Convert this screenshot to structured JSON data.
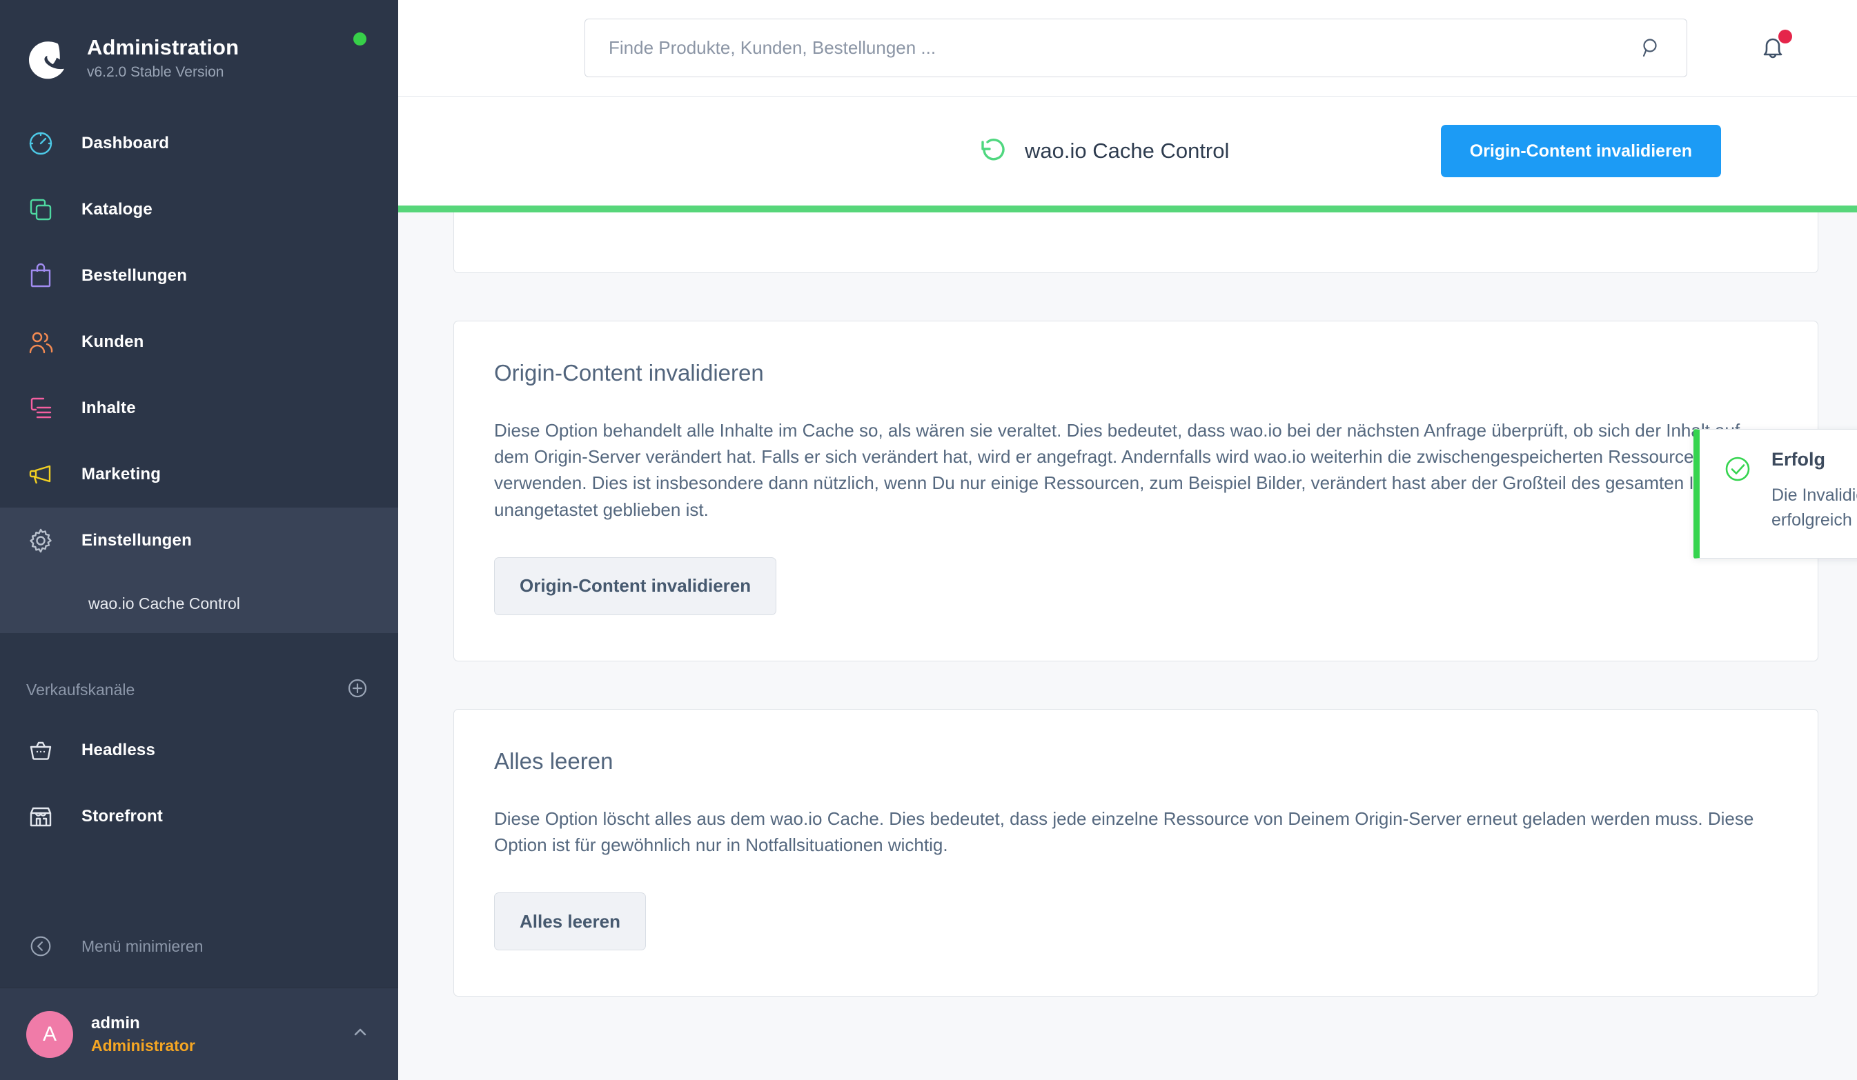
{
  "sidebar": {
    "brand": {
      "title": "Administration",
      "version": "v6.2.0 Stable Version",
      "logo_icon": "shopware-logo-icon",
      "status_icon": "status-online-dot"
    },
    "nav_items": [
      {
        "label": "Dashboard",
        "icon": "speedometer-icon",
        "color": "#4dc9e6"
      },
      {
        "label": "Kataloge",
        "icon": "copy-layers-icon",
        "color": "#4ed8a0"
      },
      {
        "label": "Bestellungen",
        "icon": "shopping-bag-icon",
        "color": "#a18cf0"
      },
      {
        "label": "Kunden",
        "icon": "users-icon",
        "color": "#f58b52"
      },
      {
        "label": "Inhalte",
        "icon": "content-list-icon",
        "color": "#f55fa0"
      },
      {
        "label": "Marketing",
        "icon": "megaphone-icon",
        "color": "#f2d022"
      },
      {
        "label": "Einstellungen",
        "icon": "gear-icon",
        "color": "#b9c1cd"
      }
    ],
    "sub_item": {
      "label": "wao.io Cache Control"
    },
    "sales_channels": {
      "title": "Verkaufskanäle",
      "add_icon": "plus-circle-icon",
      "items": [
        {
          "label": "Headless",
          "icon": "basket-icon"
        },
        {
          "label": "Storefront",
          "icon": "storefront-icon"
        }
      ]
    },
    "minimize": {
      "label": "Menü minimieren",
      "icon": "chevron-left-circle-icon"
    },
    "user": {
      "avatar_initial": "A",
      "avatar_color": "#f07ba8",
      "name": "admin",
      "role": "Administrator",
      "role_color": "#f5a623",
      "expand_icon": "chevron-up-icon"
    }
  },
  "topbar": {
    "search": {
      "placeholder": "Finde Produkte, Kunden, Bestellungen ...",
      "value": "",
      "icon": "search-icon"
    },
    "notifications": {
      "icon": "bell-icon",
      "badge_icon": "notification-dot",
      "badge_color": "#e5254a"
    }
  },
  "pageheader": {
    "icon": "refresh-circle-arrow-icon",
    "icon_color": "#4fd77f",
    "title": "wao.io Cache Control",
    "primary_button": "Origin-Content invalidieren",
    "primary_button_color": "#1c9bf5"
  },
  "progress": {
    "color": "#57d67a"
  },
  "cards": [
    {
      "title": "Origin-Content invalidieren",
      "text": "Diese Option behandelt alle Inhalte im Cache so, als wären sie veraltet. Dies bedeutet, dass wao.io bei der nächsten Anfrage überprüft, ob sich der Inhalt auf dem Origin-Server verändert hat. Falls er sich verändert hat, wird er angefragt. Andernfalls wird wao.io weiterhin die zwischengespeicherten Ressourcen verwenden. Dies ist insbesondere dann nützlich, wenn Du nur einige Ressourcen, zum Beispiel Bilder, verändert hast aber der Großteil des gesamten Inhalts unangetastet geblieben ist.",
      "button": "Origin-Content invalidieren"
    },
    {
      "title": "Alles leeren",
      "text": "Diese Option löscht alles aus dem wao.io Cache. Dies bedeutet, dass jede einzelne Ressource von Deinem Origin-Server erneut geladen werden muss. Diese Option ist für gewöhnlich nur in Notfallsituationen wichtig.",
      "button": "Alles leeren"
    }
  ],
  "toast": {
    "icon": "check-circle-icon",
    "icon_color": "#35d44f",
    "title": "Erfolg",
    "message": "Die Invalidierung Deines Caches bei wao.io wurde erfolgreich gestartet.",
    "close_icon": "close-icon",
    "accent_color": "#35d44f"
  }
}
